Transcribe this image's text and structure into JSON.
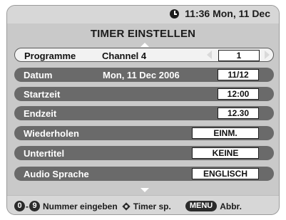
{
  "header": {
    "clock_icon": "clock-icon",
    "time": "11:36 Mon, 11 Dec",
    "title": "TIMER EINSTELLEN"
  },
  "rows": [
    {
      "label": "Programme",
      "mid": "Channel 4",
      "value": "1"
    },
    {
      "label": "Datum",
      "mid": "Mon, 11 Dec 2006",
      "value": "11/12"
    },
    {
      "label": "Startzeit",
      "value": "12:00"
    },
    {
      "label": "Endzeit",
      "value": "12.30"
    },
    {
      "label": "Wiederholen",
      "value": "EINM."
    },
    {
      "label": "Untertitel",
      "value": "KEINE"
    },
    {
      "label": "Audio Sprache",
      "value": "ENGLISCH"
    }
  ],
  "footer": {
    "key_0": "0",
    "key_9": "9",
    "dash": "-",
    "enter_text": "Nummer eingeben",
    "nav_text": "Timer sp.",
    "menu_key": "MENU",
    "menu_text": "Abbr."
  },
  "colors": {
    "panel_bg": "#c9c9c9",
    "row_bg": "#6a6a6a",
    "selected_row_bg": "#f2f2f2"
  }
}
